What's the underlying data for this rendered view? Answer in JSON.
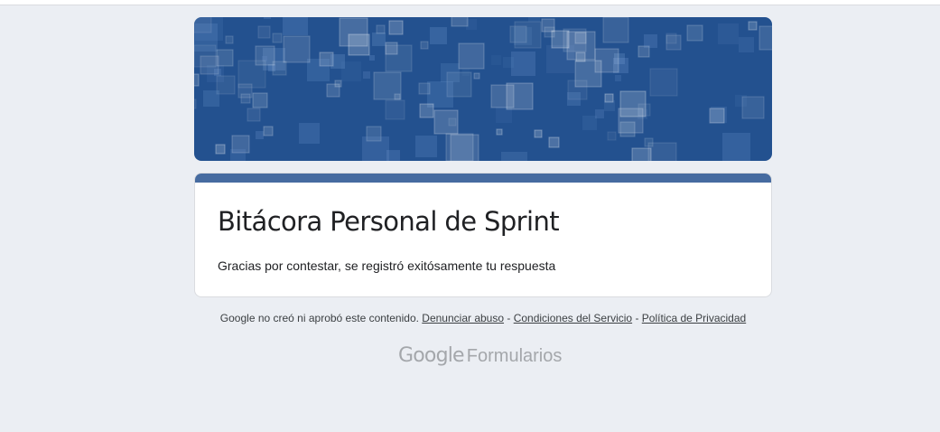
{
  "form": {
    "title": "Bitácora Personal de Sprint",
    "confirmation_message": "Gracias por contestar, se registró exitósamente tu respuesta"
  },
  "footer": {
    "disclaimer": "Google no creó ni aprobó este contenido.",
    "separator": " - ",
    "links": {
      "report_abuse": "Denunciar abuso",
      "terms": "Condiciones del Servicio",
      "privacy": "Política de Privacidad"
    }
  },
  "branding": {
    "google": "Google",
    "product": "Formularios"
  },
  "colors": {
    "page_background": "#ebeef3",
    "banner": "#23518f",
    "card_accent": "#466ba0",
    "text": "#202124",
    "brand_gray": "#a4a7ab"
  },
  "icons": {
    "banner_image": "floating-squares-pattern"
  }
}
